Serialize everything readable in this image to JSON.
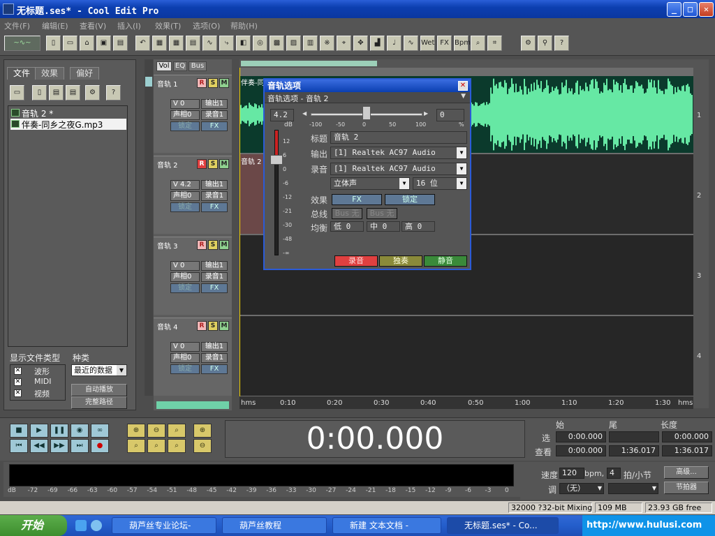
{
  "window": {
    "title": "无标题.ses* - Cool Edit Pro"
  },
  "menu": [
    "文件(F)",
    "编辑(E)",
    "查看(V)",
    "插入(I)",
    "效果(T)",
    "选项(O)",
    "帮助(H)"
  ],
  "left_panel": {
    "tabs": [
      "文件",
      "效果",
      "偏好"
    ],
    "files": [
      "音轨 2 *",
      "伴奏-同乡之夜G.mp3"
    ],
    "show_types_label": "显示文件类型",
    "type_options": [
      {
        "label": "波形",
        "checked": true
      },
      {
        "label": "MIDI",
        "checked": true
      },
      {
        "label": "视频",
        "checked": true
      }
    ],
    "sort_label": "种类",
    "sort_value": "最近的数据",
    "auto_play": "自动播放",
    "full_path": "完整路径"
  },
  "track_tabs": [
    "Vol",
    "EQ",
    "Bus"
  ],
  "tracks": [
    {
      "name": "音轨 1",
      "vol": "V 0",
      "out": "输出1",
      "pan": "声相0",
      "rec": "录音1",
      "lock": "锁定",
      "fx": "FX",
      "r_active": false
    },
    {
      "name": "音轨 2",
      "vol": "V 4.2",
      "out": "输出1",
      "pan": "声相0",
      "rec": "录音1",
      "lock": "锁定",
      "fx": "FX",
      "r_active": true
    },
    {
      "name": "音轨 3",
      "vol": "V 0",
      "out": "输出1",
      "pan": "声相0",
      "rec": "录音1",
      "lock": "锁定",
      "fx": "FX",
      "r_active": false
    },
    {
      "name": "音轨 4",
      "vol": "V 0",
      "out": "输出1",
      "pan": "声相0",
      "rec": "录音1",
      "lock": "锁定",
      "fx": "FX",
      "r_active": false
    }
  ],
  "rsm": [
    "R",
    "S",
    "M"
  ],
  "waveform": {
    "clip1_label": "伴奏-同",
    "clip2_label": "音轨 2",
    "track_numbers": [
      "1",
      "2",
      "3",
      "4"
    ],
    "ruler": [
      "hms",
      "0:10",
      "0:20",
      "0:30",
      "0:40",
      "0:50",
      "1:00",
      "1:10",
      "1:20",
      "1:30",
      "hms"
    ],
    "colors": {
      "wave": "#66e8a4",
      "wave_bg": "#0b3a2c",
      "clip2": "#6b4848"
    }
  },
  "dialog": {
    "title": "音轨选项",
    "subtitle": "音轨选项 - 音轨 2",
    "volume_value": "4.2",
    "db_label": "dB",
    "db_scale": [
      "12",
      "6",
      "0",
      "-6",
      "-12",
      "-21",
      "-30",
      "-48",
      "-∞"
    ],
    "pan_scale": [
      "-100",
      "-50",
      "0",
      "50",
      "100"
    ],
    "pan_value": "0",
    "pan_unit": "%",
    "title_label": "标题",
    "title_value": "音轨 2",
    "output_label": "输出",
    "output_value": "[1] Realtek AC97 Audio",
    "record_label": "录音",
    "record_value": "[1] Realtek AC97 Audio",
    "channel_value": "立体声",
    "bits_value": "16 位",
    "effects_label": "效果",
    "fx_button": "FX",
    "lock_button": "锁定",
    "bus_label": "总线",
    "bus_values": [
      "Bus 无",
      "Bus 无"
    ],
    "eq_label": "均衡",
    "eq_low": "低 0",
    "eq_mid": "中 0",
    "eq_high": "高 0",
    "btn_record": "录音",
    "btn_solo": "独奏",
    "btn_mute": "静音"
  },
  "transport": {
    "time": "0:00.000",
    "headers": [
      "始",
      "尾",
      "长度"
    ],
    "sel_label": "选",
    "view_label": "查看",
    "sel_start": "0:00.000",
    "sel_end": "",
    "sel_len": "0:00.000",
    "view_start": "0:00.000",
    "view_end": "1:36.017",
    "view_len": "1:36.017",
    "tempo_label": "速度",
    "tempo_value": "120",
    "tempo_unit": "bpm,",
    "beats_value": "4",
    "beats_label": "拍/小节",
    "key_label": "调",
    "key_value": "（无）",
    "advanced": "高级...",
    "metronome": "节拍器"
  },
  "meter_ticks": [
    "dB",
    "-72",
    "-69",
    "-66",
    "-63",
    "-60",
    "-57",
    "-54",
    "-51",
    "-48",
    "-45",
    "-42",
    "-39",
    "-36",
    "-33",
    "-30",
    "-27",
    "-24",
    "-21",
    "-18",
    "-15",
    "-12",
    "-9",
    "-6",
    "-3",
    "0"
  ],
  "status": {
    "format": "32000 ?32-bit Mixing",
    "memory": "109 MB",
    "disk": "23.93 GB free"
  },
  "taskbar": {
    "start": "开始",
    "tasks": [
      "葫芦丝专业论坛-",
      "葫芦丝教程",
      "新建 文本文档 -",
      "无标题.ses* - Co..."
    ],
    "tray_text": "http://www.hulusi.com"
  }
}
